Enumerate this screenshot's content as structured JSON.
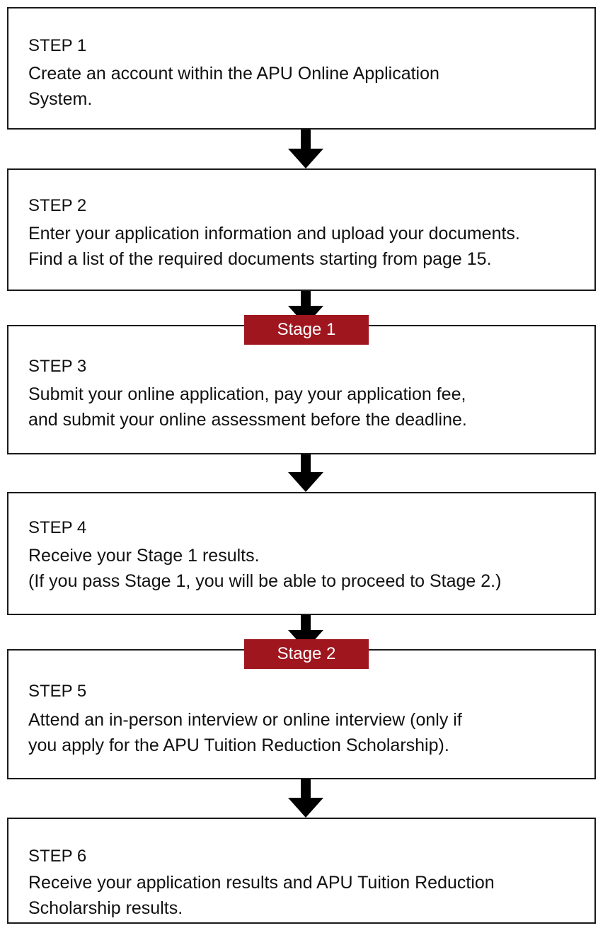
{
  "steps": [
    {
      "label": "STEP 1",
      "lines": [
        "Create an account within the APU Online Application",
        "System."
      ]
    },
    {
      "label": "STEP 2",
      "lines": [
        "Enter your application information and upload your documents.",
        "Find a list of the required documents starting from page 15."
      ]
    },
    {
      "label": "STEP 3",
      "lines": [
        "Submit your online application, pay your application fee,",
        "and submit your online assessment before the deadline."
      ]
    },
    {
      "label": "STEP 4",
      "lines": [
        "Receive your Stage 1 results.",
        "(If you pass Stage 1, you will be able to proceed to Stage 2.)"
      ]
    },
    {
      "label": "STEP 5",
      "lines": [
        "Attend an in-person interview or online interview (only if",
        "you apply for the APU Tuition Reduction Scholarship)."
      ]
    },
    {
      "label": "STEP 6",
      "lines": [
        "Receive your application results and APU Tuition Reduction",
        "Scholarship results."
      ]
    }
  ],
  "stages": [
    {
      "label": "Stage 1"
    },
    {
      "label": "Stage 2"
    }
  ],
  "colors": {
    "stage_badge": "#a0161e",
    "border": "#1a1a1a",
    "arrow": "#000000"
  }
}
